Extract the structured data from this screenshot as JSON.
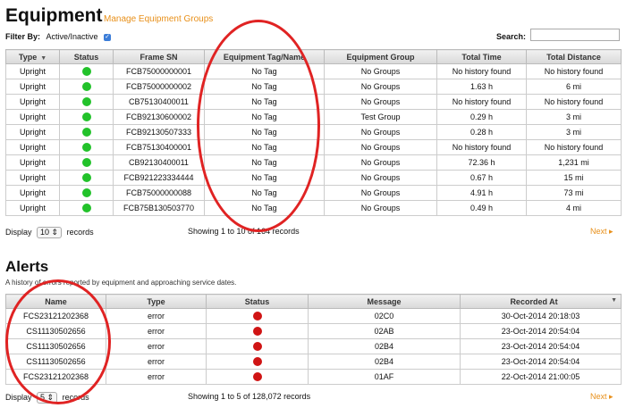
{
  "equipment": {
    "title": "Equipment",
    "manage_link": "Manage Equipment Groups",
    "filter_label": "Filter By:",
    "filter_value": "Active/Inactive",
    "filter_checked": true,
    "search_label": "Search:",
    "search_value": "",
    "columns": [
      "Type",
      "Status",
      "Frame SN",
      "Equipment Tag/Name",
      "Equipment Group",
      "Total Time",
      "Total Distance"
    ],
    "rows": [
      {
        "type": "Upright",
        "status": "green",
        "frame": "FCB75000000001",
        "tag": "No Tag",
        "group": "No Groups",
        "time": "No history found",
        "dist": "No history found"
      },
      {
        "type": "Upright",
        "status": "green",
        "frame": "FCB75000000002",
        "tag": "No Tag",
        "group": "No Groups",
        "time": "1.63 h",
        "dist": "6 mi"
      },
      {
        "type": "Upright",
        "status": "green",
        "frame": "CB75130400011",
        "tag": "No Tag",
        "group": "No Groups",
        "time": "No history found",
        "dist": "No history found"
      },
      {
        "type": "Upright",
        "status": "green",
        "frame": "FCB92130600002",
        "tag": "No Tag",
        "group": "Test Group",
        "time": "0.29 h",
        "dist": "3 mi"
      },
      {
        "type": "Upright",
        "status": "green",
        "frame": "FCB92130507333",
        "tag": "No Tag",
        "group": "No Groups",
        "time": "0.28 h",
        "dist": "3 mi"
      },
      {
        "type": "Upright",
        "status": "green",
        "frame": "FCB75130400001",
        "tag": "No Tag",
        "group": "No Groups",
        "time": "No history found",
        "dist": "No history found"
      },
      {
        "type": "Upright",
        "status": "green",
        "frame": "CB92130400011",
        "tag": "No Tag",
        "group": "No Groups",
        "time": "72.36 h",
        "dist": "1,231 mi"
      },
      {
        "type": "Upright",
        "status": "green",
        "frame": "FCB921223334444",
        "tag": "No Tag",
        "group": "No Groups",
        "time": "0.67 h",
        "dist": "15 mi"
      },
      {
        "type": "Upright",
        "status": "green",
        "frame": "FCB75000000088",
        "tag": "No Tag",
        "group": "No Groups",
        "time": "4.91 h",
        "dist": "73 mi"
      },
      {
        "type": "Upright",
        "status": "green",
        "frame": "FCB75B130503770",
        "tag": "No Tag",
        "group": "No Groups",
        "time": "0.49 h",
        "dist": "4 mi"
      }
    ],
    "display_label": "Display",
    "display_value": "10",
    "records_label": "records",
    "showing": "Showing 1 to 10 of 164 records",
    "next": "Next"
  },
  "alerts": {
    "title": "Alerts",
    "description": "A history of errors reported by equipment and approaching service dates.",
    "columns": [
      "Name",
      "Type",
      "Status",
      "Message",
      "Recorded At"
    ],
    "rows": [
      {
        "name": "FCS23121202368",
        "type": "error",
        "status": "red",
        "message": "02C0",
        "recorded": "30-Oct-2014 20:18:03"
      },
      {
        "name": "CS11130502656",
        "type": "error",
        "status": "red",
        "message": "02AB",
        "recorded": "23-Oct-2014 20:54:04"
      },
      {
        "name": "CS11130502656",
        "type": "error",
        "status": "red",
        "message": "02B4",
        "recorded": "23-Oct-2014 20:54:04"
      },
      {
        "name": "CS11130502656",
        "type": "error",
        "status": "red",
        "message": "02B4",
        "recorded": "23-Oct-2014 20:54:04"
      },
      {
        "name": "FCS23121202368",
        "type": "error",
        "status": "red",
        "message": "01AF",
        "recorded": "22-Oct-2014 21:00:05"
      }
    ],
    "display_label": "Display",
    "display_value": "5",
    "records_label": "records",
    "showing": "Showing 1 to 5 of 128,072 records",
    "next": "Next"
  },
  "colors": {
    "green": "#22c22a",
    "red": "#d01414",
    "accent": "#e8901a",
    "annotation": "#e02323"
  }
}
